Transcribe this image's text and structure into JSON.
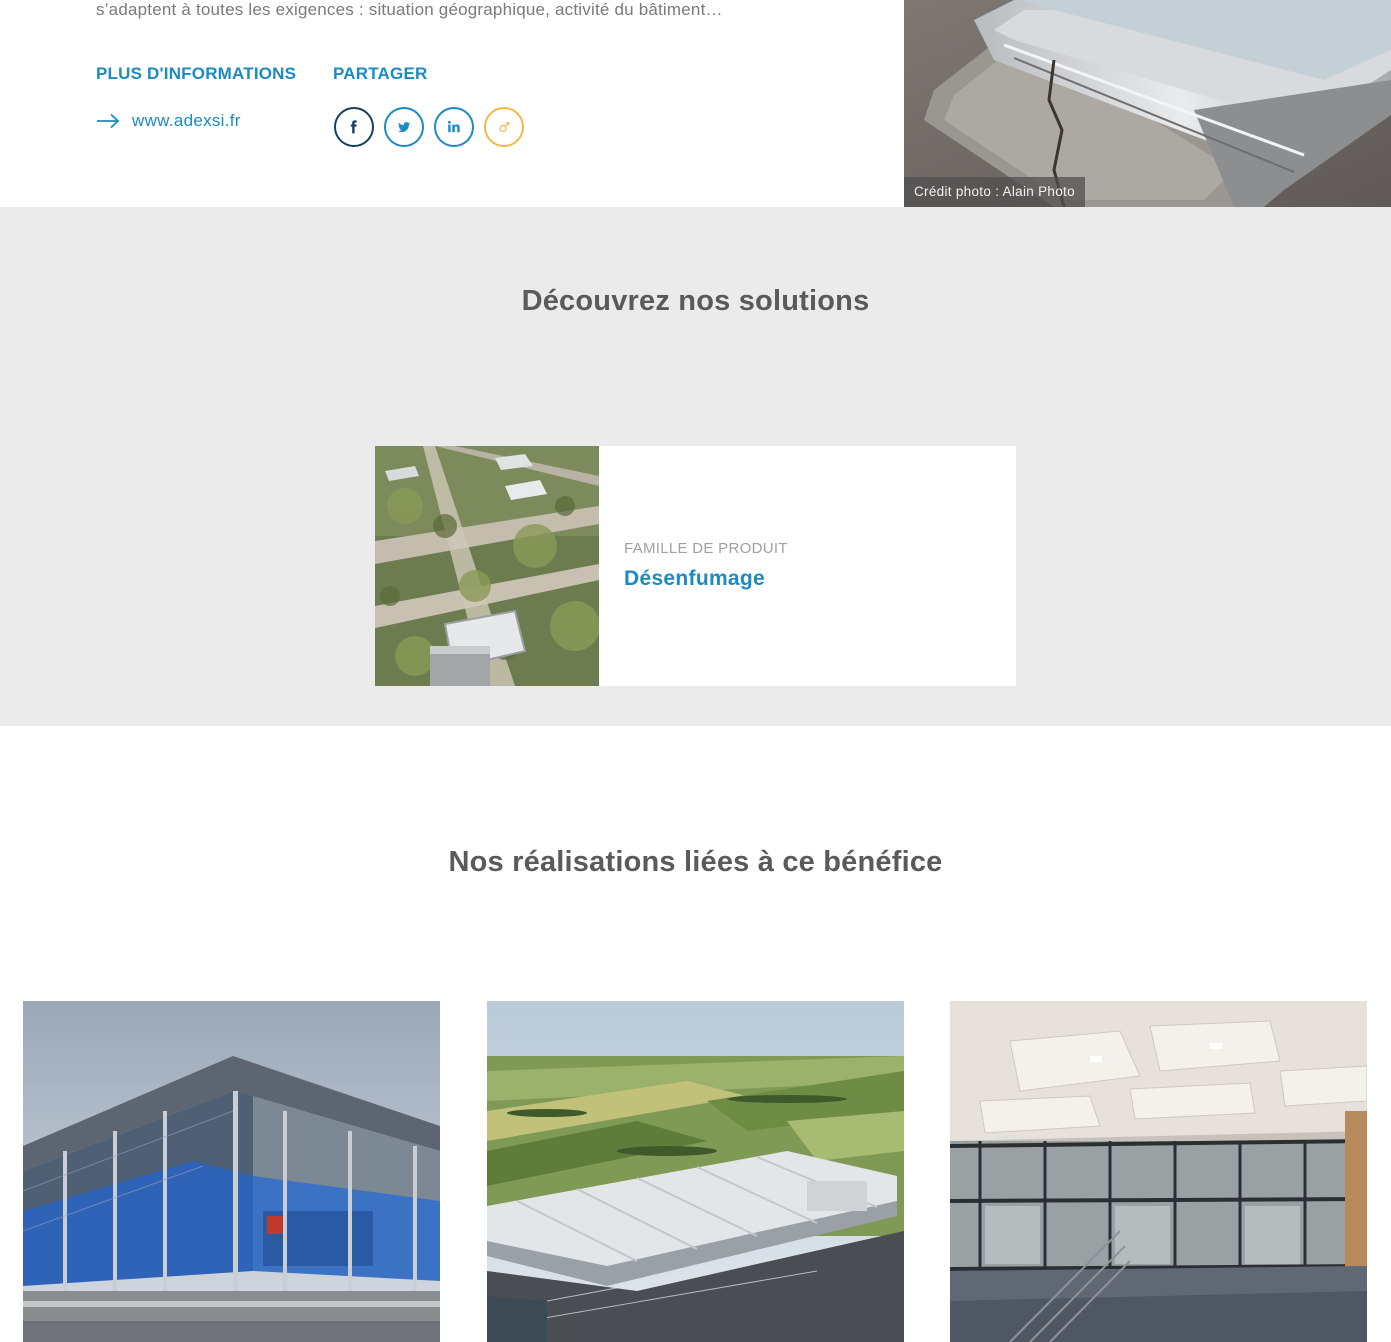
{
  "intro_text": "s’adaptent à toutes les exigences : situation géographique, activité du bâtiment…",
  "info": {
    "title": "PLUS D'INFORMATIONS",
    "link_label": "www.adexsi.fr"
  },
  "share": {
    "title": "PARTAGER",
    "buttons": [
      {
        "icon": "facebook-icon",
        "color": "#1a3d60"
      },
      {
        "icon": "twitter-icon",
        "color": "#1d8ac0"
      },
      {
        "icon": "linkedin-icon",
        "color": "#1d8ac0"
      },
      {
        "icon": "mail-icon",
        "color": "#f1b943"
      }
    ]
  },
  "photo_credit": "Crédit photo : Alain Photo",
  "solutions": {
    "heading": "Découvrez nos solutions",
    "card": {
      "label": "FAMILLE DE PRODUIT",
      "title": "Désenfumage"
    }
  },
  "realisations": {
    "heading": "Nos réalisations liées à ce bénéfice"
  },
  "colors": {
    "accent": "#1d8ac0",
    "heading": "#5a5a5a",
    "section_bg": "#ebebeb",
    "mail_accent": "#f1b943"
  }
}
